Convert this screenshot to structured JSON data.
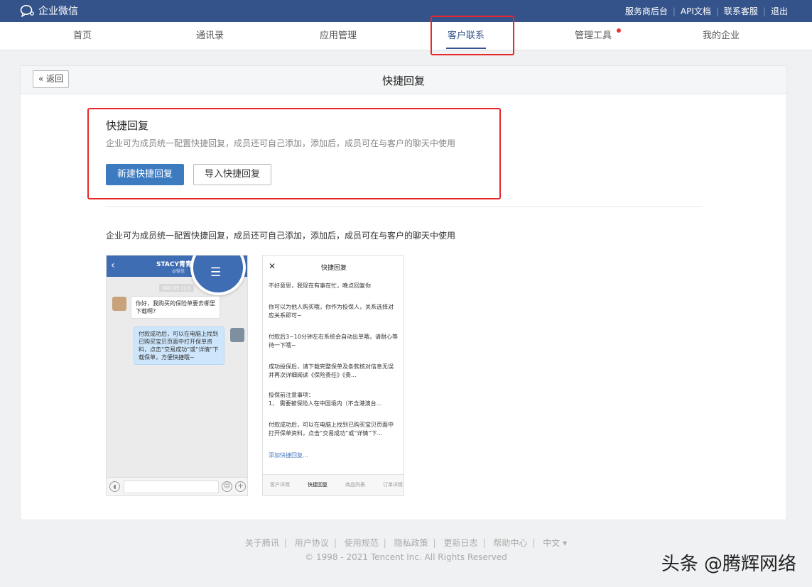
{
  "brand": {
    "name": "企业微信"
  },
  "top_links": [
    "服务商后台",
    "API文档",
    "联系客服",
    "退出"
  ],
  "nav": {
    "items": [
      {
        "label": "首页"
      },
      {
        "label": "通讯录"
      },
      {
        "label": "应用管理"
      },
      {
        "label": "客户联系",
        "active": true
      },
      {
        "label": "管理工具",
        "badge": true
      },
      {
        "label": "我的企业"
      }
    ]
  },
  "card": {
    "back_label": "返回",
    "title": "快捷回复",
    "section_title": "快捷回复",
    "section_desc": "企业可为成员统一配置快捷回复，成员还可自己添加，添加后，成员可在与客户的聊天中使用",
    "primary_button": "新建快捷回复",
    "secondary_button": "导入快捷回复",
    "intro": "企业可为成员统一配置快捷回复，成员还可自己添加，添加后，成员可在与客户的聊天中使用"
  },
  "phone1": {
    "title": "STACY青青",
    "subtitle": "@微信",
    "date": "8月13日 11:0",
    "message_in": "你好，我购买的保险单要去哪里下载啊?",
    "message_out": "付款成功后，可以在电脑上找到已购买宝贝页面中打开保单资料，点击“交易成功”或“详情”下载保单，方便快捷哦~"
  },
  "phone2": {
    "title": "快捷回复",
    "items": [
      "不好意思，我现在有事在忙，晚点回复你",
      "你可以为他人购买哦，你作为投保人，关系选择对应关系即可~",
      "付款后3~10分钟左右系统会自动出单哦，请耐心等待一下哦~",
      "成功投保后，请下载完整保单及条款核对信息无误并再次详细阅读《保险责任》《责...",
      "投保前注意事项：\n1、 需要被保险人在中国境内（不含港澳台...",
      "付款成功后，可以在电脑上找到已购买宝贝页面中打开保单资料，点击“交易成功”或“详情”下..."
    ],
    "add_link": "添加快捷回复...",
    "tabs": [
      "客户详情",
      "快捷回复",
      "商品列表",
      "订单详情"
    ]
  },
  "footer": {
    "links": [
      "关于腾讯",
      "用户协议",
      "使用规范",
      "隐私政策",
      "更新日志",
      "帮助中心",
      "中文 ▾"
    ],
    "copyright": "© 1998 - 2021 Tencent Inc. All Rights Reserved"
  },
  "watermark": "头条 @腾辉网络",
  "colors": {
    "header_bg": "#34538a",
    "primary": "#3d7bc1",
    "highlight_border": "#e8272a"
  }
}
